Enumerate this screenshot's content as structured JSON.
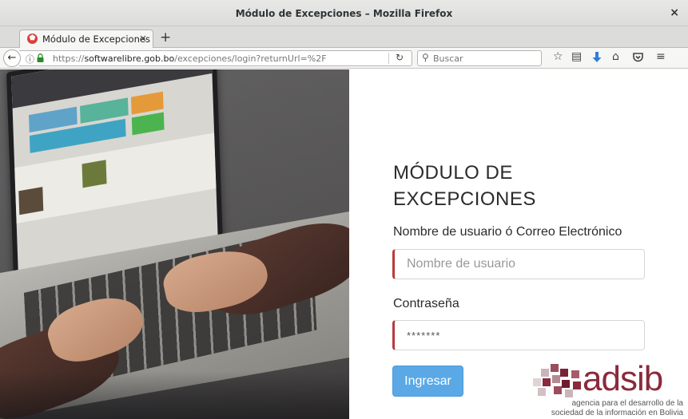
{
  "window": {
    "title": "Módulo de Excepciones – Mozilla Firefox",
    "close_label": "×"
  },
  "tab": {
    "label": "Módulo de Excepciones",
    "close_label": "×",
    "new_tab_label": "+"
  },
  "navbar": {
    "url_scheme": "https://",
    "url_host": "softwarelibre.gob.bo",
    "url_path": "/excepciones/login?returnUrl=%2F",
    "search_placeholder": "Buscar",
    "icons": [
      "back-icon",
      "info-icon",
      "lock-icon",
      "reload-icon",
      "search-icon",
      "bookmark-star-icon",
      "reading-list-icon",
      "download-icon",
      "home-icon",
      "pocket-icon",
      "menu-icon"
    ]
  },
  "form": {
    "title_line1": "MÓDULO DE",
    "title_line2": "EXCEPCIONES",
    "username_label": "Nombre de usuario ó Correo Electrónico",
    "username_placeholder": "Nombre de usuario",
    "password_label": "Contraseña",
    "password_value": "*******",
    "submit_label": "Ingresar"
  },
  "logo": {
    "wordmark": "adsib",
    "tagline_line1": "agencia para el desarrollo de la",
    "tagline_line2": "sociedad de la información en Bolivia"
  },
  "colors": {
    "accent_button": "#5aa9e6",
    "field_left_border": "#b83a3f",
    "logo_color": "#8a2a3c",
    "favicon": "#d9413a"
  }
}
